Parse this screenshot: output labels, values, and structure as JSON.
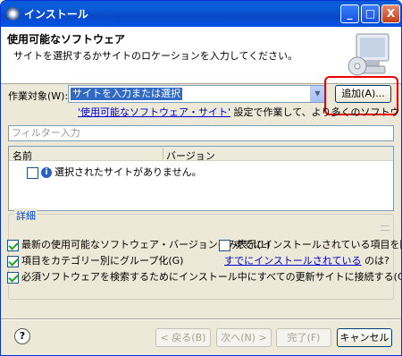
{
  "window": {
    "title": "インストール",
    "buttons": {
      "minimize": "_",
      "maximize": "□",
      "close": "X"
    }
  },
  "header": {
    "title": "使用可能なソフトウェア",
    "subtitle": "サイトを選択するかサイトのロケーションを入力してください。"
  },
  "work": {
    "label": "作業対象(W):",
    "value": "サイトを入力または選択",
    "add_label": "追加(A)..."
  },
  "info": {
    "link": "'使用可能なソフトウェア・サイト'",
    "text": "設定で作業して、より多くのソフトウェアを検索してください。"
  },
  "filter": {
    "placeholder": "フィルター入力"
  },
  "tree": {
    "col_name": "名前",
    "col_version": "バージョン",
    "empty_row": "選択されたサイトがありません。"
  },
  "details": {
    "legend": "詳細"
  },
  "options": {
    "latest_only": {
      "label": "最新の使用可能なソフトウェア・バージョンのみ表示(L)",
      "checked": true
    },
    "hide_installed": {
      "label": "すでにインストールされている項目を隠す(H)",
      "checked": false
    },
    "group_by_category": {
      "label": "項目をカテゴリー別にグループ化(G)",
      "checked": true
    },
    "what_installed_link": "すでにインストールされている",
    "what_installed_suffix": "のは?",
    "contact_all": {
      "label": "必須ソフトウェアを検索するためにインストール中にすべての更新サイトに接続する(C)",
      "checked": true
    }
  },
  "footer": {
    "help": "?",
    "back": "< 戻る(B)",
    "next": "次へ(N) >",
    "finish": "完了(F)",
    "cancel": "キャンセル"
  }
}
